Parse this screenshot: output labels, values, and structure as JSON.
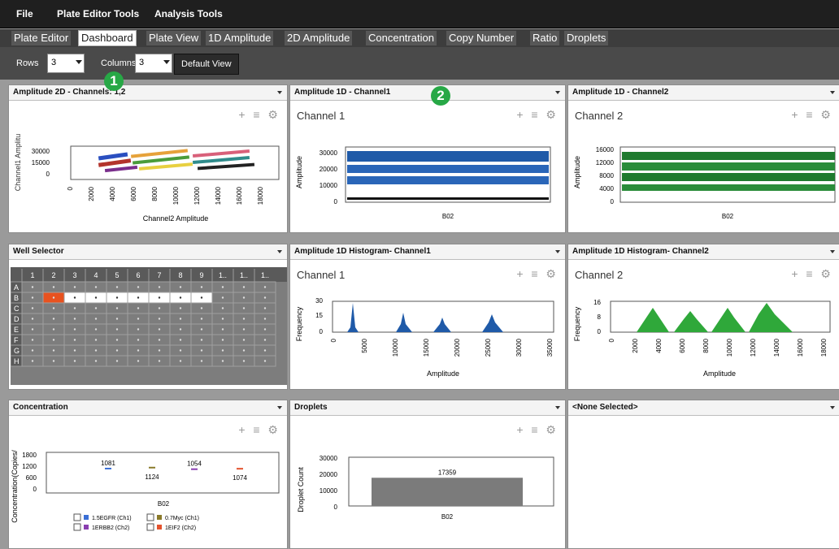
{
  "menu": [
    "File",
    "Plate Editor Tools",
    "Analysis Tools"
  ],
  "tabs": [
    "Plate Editor",
    "Dashboard",
    "Plate View",
    "1D Amplitude",
    "2D Amplitude",
    "Concentration",
    "Copy Number",
    "Ratio",
    "Droplets"
  ],
  "active_tab": "Dashboard",
  "toolbar": {
    "rows_label": "Rows",
    "rows_value": "3",
    "columns_label": "Columns",
    "columns_value": "3",
    "default_view": "Default View"
  },
  "badges": [
    "1",
    "2"
  ],
  "tools_glyphs": "+ ≡ ⚙",
  "panels": {
    "amp2d": {
      "title": "Amplitude 2D - Channels: 1,2",
      "ylabel": "Channel1 Amplitu",
      "xlabel": "Channel2 Amplitude",
      "yticks": [
        "30000",
        "15000",
        "0"
      ],
      "xticks": [
        "0",
        "2000",
        "4000",
        "6000",
        "8000",
        "10000",
        "12000",
        "14000",
        "16000",
        "18000"
      ]
    },
    "amp1d_c1": {
      "title": "Amplitude 1D - Channel1",
      "channel": "Channel 1",
      "ylabel": "Amplitude",
      "yticks": [
        "30000",
        "20000",
        "10000",
        "0"
      ],
      "xtick": "B02"
    },
    "amp1d_c2": {
      "title": "Amplitude 1D - Channel2",
      "channel": "Channel 2",
      "ylabel": "Amplitude",
      "yticks": [
        "16000",
        "12000",
        "8000",
        "4000",
        "0"
      ],
      "xtick": "B02"
    },
    "well": {
      "title": "Well Selector",
      "cols": [
        "1",
        "2",
        "3",
        "4",
        "5",
        "6",
        "7",
        "8",
        "9",
        "1..",
        "1..",
        "1.."
      ],
      "rows": [
        "A",
        "B",
        "C",
        "D",
        "E",
        "F",
        "G",
        "H"
      ]
    },
    "hist_c1": {
      "title": "Amplitude 1D Histogram- Channel1",
      "channel": "Channel 1",
      "ylabel": "Frequency",
      "xlabel": "Amplitude",
      "yticks": [
        "30",
        "15",
        "0"
      ],
      "xticks": [
        "0",
        "5000",
        "10000",
        "15000",
        "20000",
        "25000",
        "30000",
        "35000"
      ]
    },
    "hist_c2": {
      "title": "Amplitude 1D Histogram- Channel2",
      "channel": "Channel 2",
      "ylabel": "Frequency",
      "xlabel": "Amplitude",
      "yticks": [
        "16",
        "8",
        "0"
      ],
      "xticks": [
        "0",
        "2000",
        "4000",
        "6000",
        "8000",
        "10000",
        "12000",
        "14000",
        "16000",
        "18000"
      ]
    },
    "conc": {
      "title": "Concentration",
      "ylabel": "Concentration(Copies/",
      "yticks": [
        "1800",
        "1200",
        "600",
        "0"
      ],
      "xtick": "B02",
      "values": [
        "1081",
        "1124",
        "1054",
        "1074"
      ],
      "legend": [
        {
          "label": "1.5EGFR (Ch1)",
          "color": "#3b6fd6"
        },
        {
          "label": "0.7Myc (Ch1)",
          "color": "#8a7a2a"
        },
        {
          "label": "1ERBB2 (Ch2)",
          "color": "#8a3fb0"
        },
        {
          "label": "1EIF2 (Ch2)",
          "color": "#e4522d"
        }
      ]
    },
    "droplets": {
      "title": "Droplets",
      "ylabel": "Droplet Count",
      "yticks": [
        "30000",
        "20000",
        "10000",
        "0"
      ],
      "xtick": "B02",
      "value": "17359"
    },
    "none": {
      "title": "<None Selected>"
    }
  },
  "chart_data": [
    {
      "type": "bar",
      "title": "Droplets",
      "categories": [
        "B02"
      ],
      "values": [
        17359
      ],
      "ylabel": "Droplet Count",
      "ylim": [
        0,
        30000
      ]
    },
    {
      "type": "scatter",
      "title": "Concentration",
      "categories": [
        "B02"
      ],
      "series": [
        {
          "name": "1.5EGFR (Ch1)",
          "values": [
            1081
          ]
        },
        {
          "name": "0.7Myc (Ch1)",
          "values": [
            1124
          ]
        },
        {
          "name": "1ERBB2 (Ch2)",
          "values": [
            1054
          ]
        },
        {
          "name": "1EIF2 (Ch2)",
          "values": [
            1074
          ]
        }
      ],
      "ylabel": "Concentration(Copies/",
      "ylim": [
        0,
        1800
      ]
    }
  ]
}
